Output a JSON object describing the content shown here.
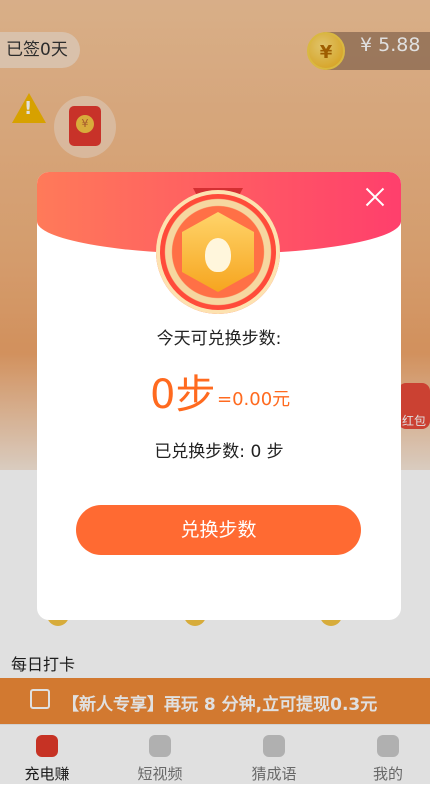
{
  "header": {
    "checkin_status": "已签0天",
    "balance": "¥ 5.88",
    "coin_symbol": "¥"
  },
  "background": {
    "redpack_symbol": "¥",
    "side_gift_label": "红包",
    "daily_checkin_title": "每日打卡"
  },
  "promo": {
    "text": "【新人专享】再玩 8 分钟,立可提现0.3元"
  },
  "tabbar": {
    "items": [
      {
        "label": "充电赚",
        "icon": "running-icon",
        "active": true
      },
      {
        "label": "短视频",
        "icon": "video-icon",
        "active": false
      },
      {
        "label": "猜成语",
        "icon": "idiom-icon",
        "active": false
      },
      {
        "label": "我的",
        "icon": "profile-icon",
        "active": false
      }
    ]
  },
  "modal": {
    "title": "今天可兑换步数:",
    "steps_value": "0步",
    "steps_equals": "=0.00元",
    "exchanged_text": "已兑换步数: 0 步",
    "button_label": "兑换步数"
  },
  "colors": {
    "accent": "#ff6a32",
    "promo_bg": "#f08a37",
    "header_gradient_start": "#ff7a59",
    "header_gradient_end": "#ff3f6c"
  }
}
